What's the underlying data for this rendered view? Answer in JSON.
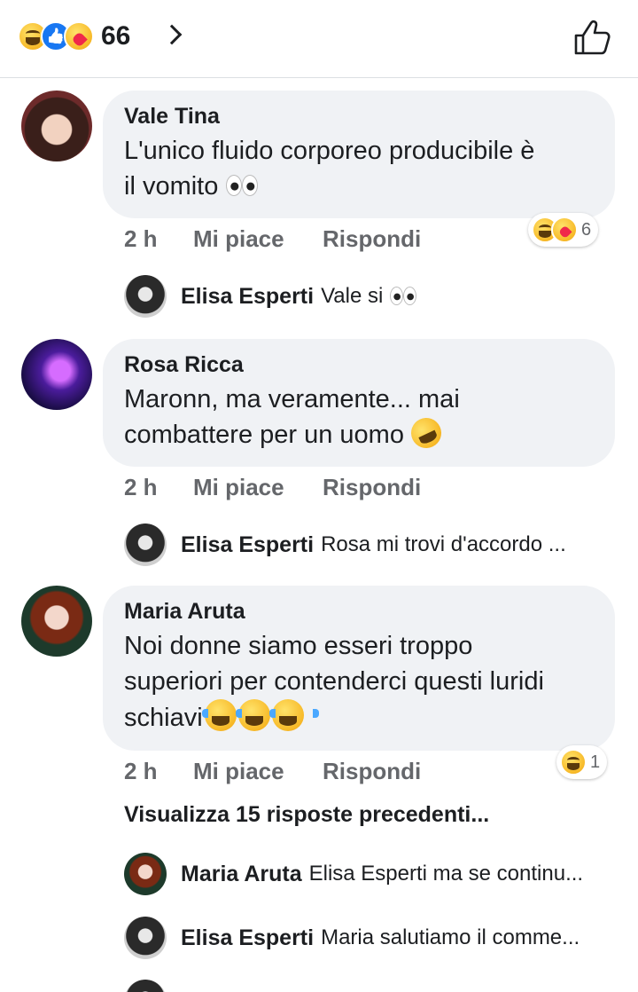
{
  "header": {
    "reactions": [
      "haha-emoji-icon",
      "like-emoji-icon",
      "care-emoji-icon"
    ],
    "reaction_count": "66"
  },
  "comments": [
    {
      "name": "Vale Tina",
      "text": "L'unico fluido corporeo producibile è\nil vomito",
      "time": "2 h",
      "like_label": "Mi piace",
      "reply_label": "Rispondi",
      "reaction_count": "6",
      "reply": {
        "name": "Elisa Esperti",
        "text": "Vale si"
      }
    },
    {
      "name": "Rosa Ricca",
      "text": "Maronn, ma veramente... mai\ncombattere per un uomo",
      "time": "2 h",
      "like_label": "Mi piace",
      "reply_label": "Rispondi",
      "reply": {
        "name": "Elisa Esperti",
        "text": "Rosa mi trovi d'accordo ..."
      }
    },
    {
      "name": "Maria Aruta",
      "text": "Noi donne siamo esseri troppo\nsuperiori per contenderci questi luridi\nschiavi",
      "time": "2 h",
      "like_label": "Mi piace",
      "reply_label": "Rispondi",
      "reaction_count": "1",
      "more_replies": "Visualizza 15 risposte precedenti...",
      "replies": [
        {
          "name": "Maria Aruta",
          "text": "Elisa Esperti ma se continu..."
        },
        {
          "name": "Elisa Esperti",
          "text": "Maria salutiamo il comme..."
        }
      ]
    }
  ],
  "colors": {
    "bubble": "#f0f2f5",
    "meta_text": "#65676b",
    "like_blue": "#1877f2"
  }
}
